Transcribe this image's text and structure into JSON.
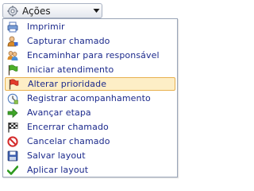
{
  "actions_button": {
    "label": "Ações",
    "icon": "gear-icon"
  },
  "menu": {
    "items": [
      {
        "label": "Imprimir",
        "icon": "printer-icon"
      },
      {
        "label": "Capturar chamado",
        "icon": "user-capture-icon"
      },
      {
        "label": "Encaminhar para responsável",
        "icon": "users-forward-icon"
      },
      {
        "label": "Iniciar atendimento",
        "icon": "green-flag-icon"
      },
      {
        "label": "Alterar prioridade",
        "icon": "red-flag-icon",
        "highlighted": true
      },
      {
        "label": "Registrar acompanhamento",
        "icon": "clock-note-icon"
      },
      {
        "label": "Avançar etapa",
        "icon": "arrow-right-icon"
      },
      {
        "label": "Encerrar chamado",
        "icon": "checkered-flag-icon"
      },
      {
        "label": "Cancelar chamado",
        "icon": "cancel-icon"
      },
      {
        "label": "Salvar layout",
        "icon": "save-icon"
      },
      {
        "label": "Aplicar layout",
        "icon": "checkmark-icon"
      }
    ]
  },
  "colors": {
    "highlight_bg": "#fdeec6",
    "highlight_border": "#e8b14f",
    "text": "#1c2a8c"
  }
}
